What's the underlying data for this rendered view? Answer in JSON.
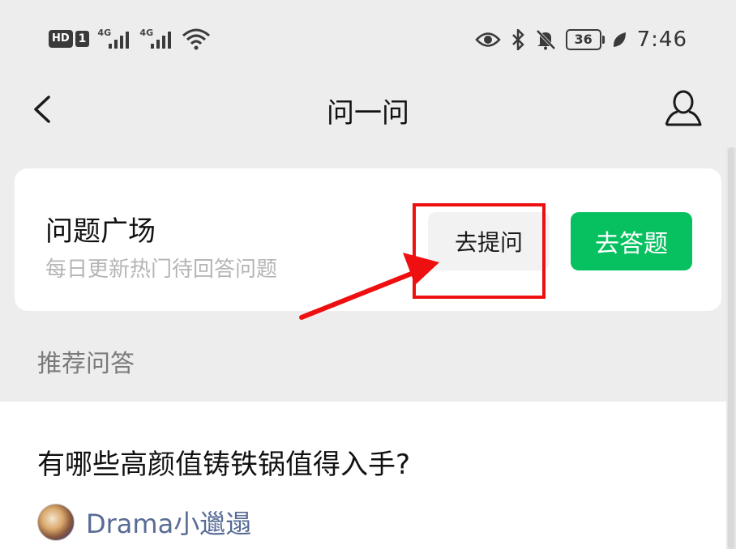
{
  "status_bar": {
    "hd_label": "HD",
    "sim_label": "1",
    "signal1_label": "4G",
    "signal2_label": "4G",
    "battery_level": "36",
    "time": "7:46"
  },
  "header": {
    "title": "问一问"
  },
  "question_square": {
    "title": "问题广场",
    "subtitle": "每日更新热门待回答问题",
    "ask_button": "去提问",
    "answer_button": "去答题"
  },
  "section": {
    "label": "推荐问答"
  },
  "recommended": [
    {
      "question": "有哪些高颜值铸铁锅值得入手?",
      "author": "Drama小邋遢"
    }
  ],
  "colors": {
    "accent_green": "#07c160",
    "highlight_red": "#ee1010",
    "link_blue": "#576b95"
  }
}
